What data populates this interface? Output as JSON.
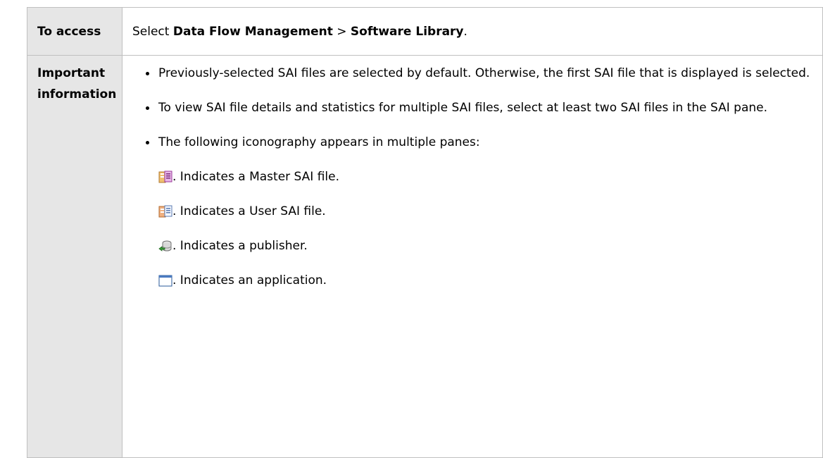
{
  "table": {
    "access": {
      "header": "To access",
      "prefix": "Select ",
      "path_first": "Data Flow Management",
      "separator": " > ",
      "path_second": "Software Library",
      "suffix": "."
    },
    "important": {
      "header_line1": "Important",
      "header_line2": "information",
      "bullets": [
        "Previously-selected SAI files are selected by default. Otherwise, the first SAI file that is displayed is selected.",
        "To view SAI file details and statistics for multiple SAI files, select at least two SAI files in the SAI pane.",
        "The following iconography appears in multiple panes:"
      ],
      "icons": [
        {
          "icon": "master-sai-file-icon",
          "text": ". Indicates a Master SAI file."
        },
        {
          "icon": "user-sai-file-icon",
          "text": ". Indicates a User SAI file."
        },
        {
          "icon": "publisher-icon",
          "text": ". Indicates a publisher."
        },
        {
          "icon": "application-icon",
          "text": ". Indicates an application."
        }
      ]
    }
  }
}
